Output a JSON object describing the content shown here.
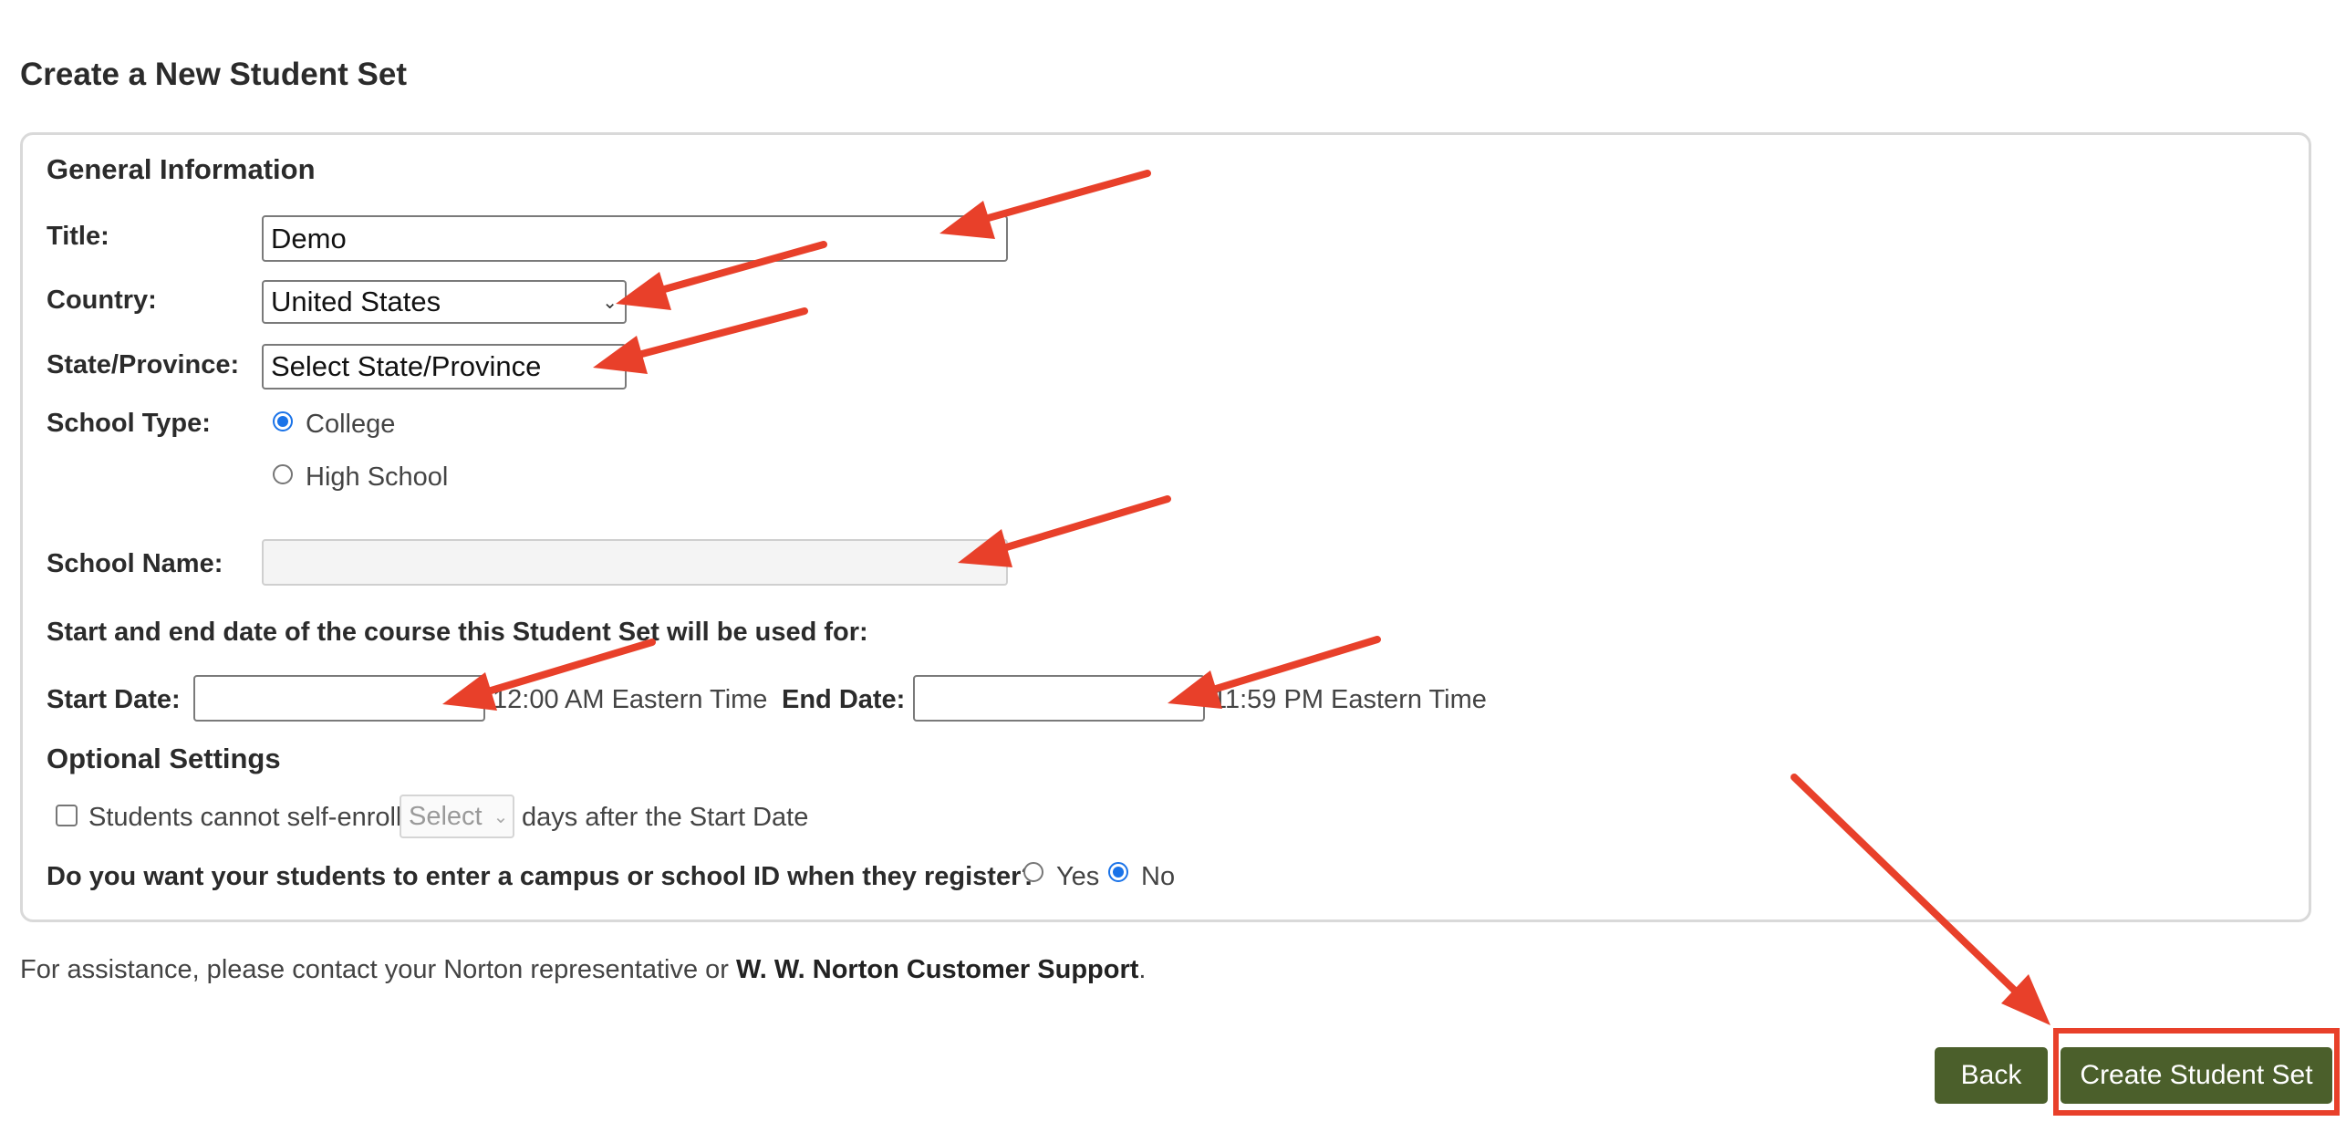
{
  "page": {
    "title": "Create a New Student Set"
  },
  "general": {
    "heading": "General Information",
    "title_label": "Title:",
    "title_value": "Demo",
    "country_label": "Country:",
    "country_value": "United States",
    "state_label": "State/Province:",
    "state_value": "Select State/Province",
    "school_type_label": "School Type:",
    "school_type_options": [
      {
        "label": "College",
        "checked": true
      },
      {
        "label": "High School",
        "checked": false
      }
    ],
    "school_name_label": "School Name:",
    "school_name_value": "",
    "dates_prompt": "Start and end date of the course this Student Set will be used for:",
    "start_label": "Start Date:",
    "start_value": "",
    "start_time": "12:00 AM Eastern Time",
    "end_label": "End Date:",
    "end_value": "",
    "end_time": "11:59 PM Eastern Time"
  },
  "optional": {
    "heading": "Optional Settings",
    "self_enroll_label": "Students cannot self-enroll",
    "self_enroll_checked": false,
    "days_select": "Select",
    "days_suffix": "days after the Start Date",
    "campus_id_question": "Do you want your students to enter a campus or school ID when they register?",
    "campus_id_options": [
      {
        "label": "Yes",
        "checked": false
      },
      {
        "label": "No",
        "checked": true
      }
    ]
  },
  "footer": {
    "assist_prefix": "For assistance, please contact your Norton representative or ",
    "assist_link": "W. W. Norton Customer Support",
    "assist_suffix": ".",
    "back_label": "Back",
    "create_label": "Create Student Set"
  },
  "colors": {
    "button": "#4b5f2b",
    "annotation": "#e8402a",
    "radio_checked": "#1a73e8"
  },
  "icons": {
    "select_chevron": "chevron-down-icon",
    "annotation_arrow": "arrow-icon"
  }
}
